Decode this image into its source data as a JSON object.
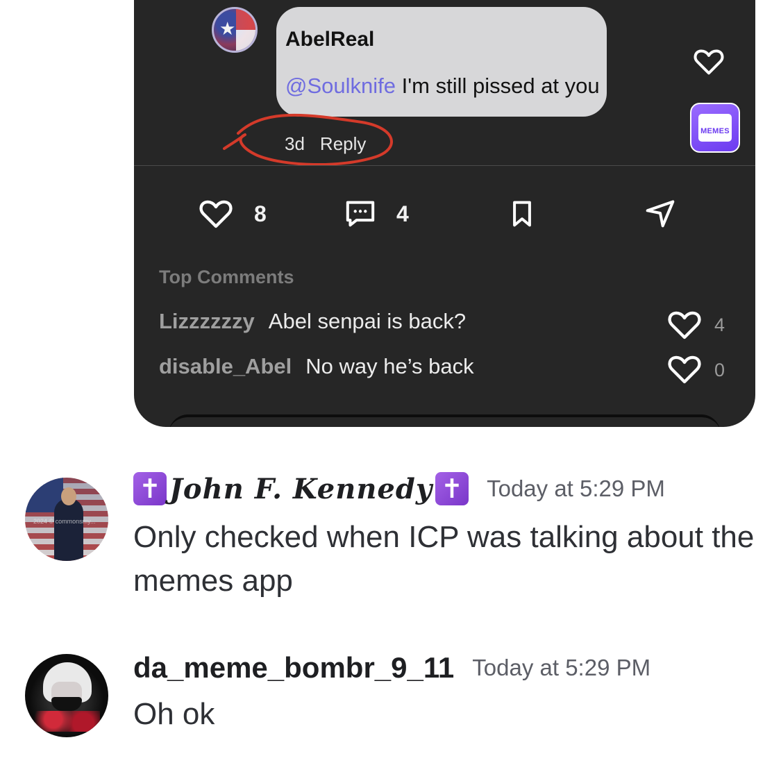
{
  "post": {
    "comment": {
      "username": "AbelReal",
      "mention": "@Soulknife",
      "text": " I'm still pissed at you",
      "age": "3d",
      "reply_label": "Reply"
    },
    "memes_app_label": "MEMES",
    "actions": {
      "likes": "8",
      "comments": "4"
    },
    "top_comments_label": "Top Comments",
    "top_comments": [
      {
        "user": "Lizzzzzzy",
        "text": "Abel senpai is back?",
        "likes": "4"
      },
      {
        "user": "disable_Abel",
        "text": "No way he’s back",
        "likes": "0"
      }
    ],
    "annotation_color": "#d43a2a"
  },
  "messages": [
    {
      "cross_left": "✝",
      "username": "John F. Kennedy",
      "cross_right": "✝",
      "timestamp": "Today at 5:29 PM",
      "text": "Only checked when ICP was talking about the memes app",
      "avatar_watermark": "2024 © commonsmy..."
    },
    {
      "username": "da_meme_bombr_9_11",
      "timestamp": "Today at 5:29 PM",
      "text": "Oh ok"
    }
  ]
}
